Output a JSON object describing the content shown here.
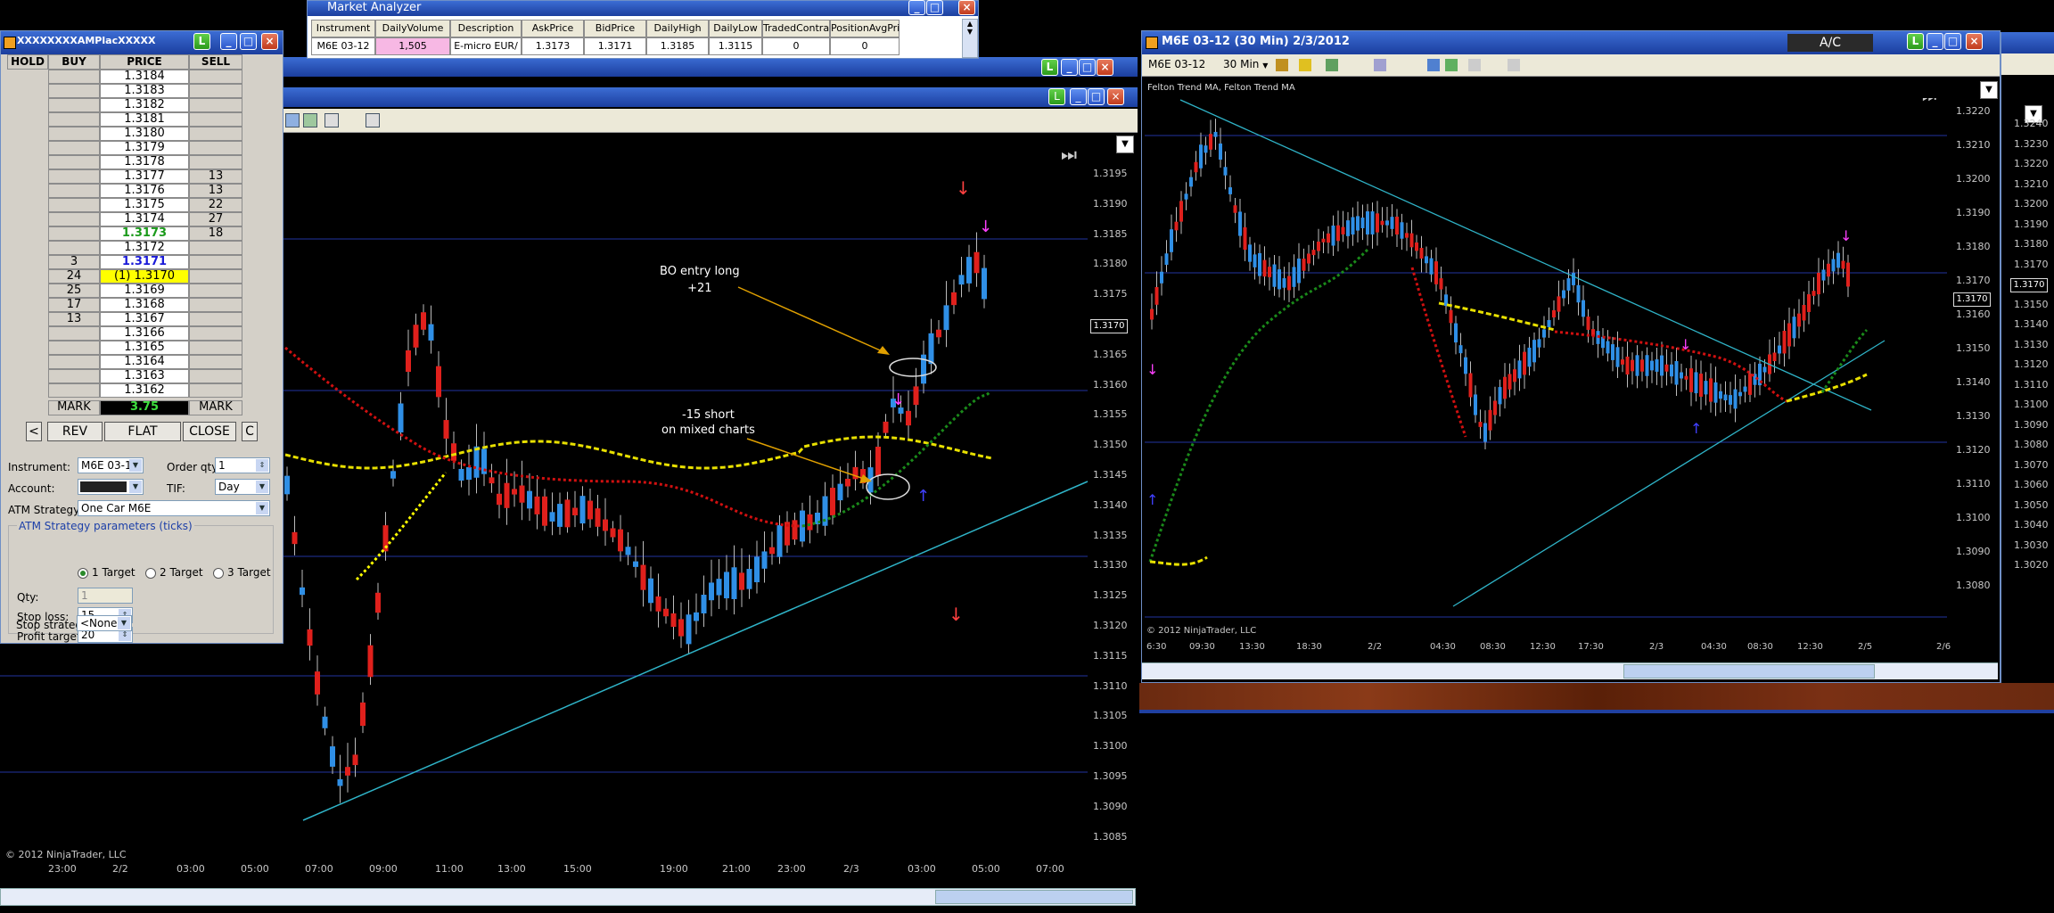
{
  "dom": {
    "title": "XXXXXXXXAMPlacXXXXX",
    "headers": [
      "HOLD",
      "BUY",
      "PRICE",
      "SELL"
    ],
    "rows": [
      {
        "buy": "",
        "price": "1.3184",
        "sell": ""
      },
      {
        "buy": "",
        "price": "1.3183",
        "sell": ""
      },
      {
        "buy": "",
        "price": "1.3182",
        "sell": ""
      },
      {
        "buy": "",
        "price": "1.3181",
        "sell": ""
      },
      {
        "buy": "",
        "price": "1.3180",
        "sell": ""
      },
      {
        "buy": "",
        "price": "1.3179",
        "sell": ""
      },
      {
        "buy": "",
        "price": "1.3178",
        "sell": ""
      },
      {
        "buy": "",
        "price": "1.3177",
        "sell": "13"
      },
      {
        "buy": "",
        "price": "1.3176",
        "sell": "13"
      },
      {
        "buy": "",
        "price": "1.3175",
        "sell": "22"
      },
      {
        "buy": "",
        "price": "1.3174",
        "sell": "27"
      },
      {
        "buy": "",
        "price": "1.3173",
        "sell": "18"
      },
      {
        "buy": "",
        "price": "1.3172",
        "sell": ""
      },
      {
        "buy": "3",
        "price": "1.3171",
        "sell": ""
      },
      {
        "buy": "24",
        "price": "(1) 1.3170",
        "sell": ""
      },
      {
        "buy": "25",
        "price": "1.3169",
        "sell": ""
      },
      {
        "buy": "17",
        "price": "1.3168",
        "sell": ""
      },
      {
        "buy": "13",
        "price": "1.3167",
        "sell": ""
      },
      {
        "buy": "",
        "price": "1.3166",
        "sell": ""
      },
      {
        "buy": "",
        "price": "1.3165",
        "sell": ""
      },
      {
        "buy": "",
        "price": "1.3164",
        "sell": ""
      },
      {
        "buy": "",
        "price": "1.3163",
        "sell": ""
      },
      {
        "buy": "",
        "price": "1.3162",
        "sell": ""
      }
    ],
    "mark_left": "MARK",
    "mark_value": "3.75",
    "mark_right": "MARK",
    "btn_left": "<",
    "btn_rev": "REV",
    "btn_flat": "FLAT",
    "btn_close": "CLOSE",
    "btn_c": "C",
    "instrument_label": "Instrument:",
    "instrument_value": "M6E 03-12",
    "orderqty_label": "Order qty:",
    "orderqty_value": "1",
    "account_label": "Account:",
    "tif_label": "TIF:",
    "tif_value": "Day",
    "atm_label": "ATM Strategy:",
    "atm_value": "One Car M6E",
    "atm_params_label": "ATM Strategy parameters (ticks)",
    "target1": "1 Target",
    "target2": "2 Target",
    "target3": "3 Target",
    "qty_label": "Qty:",
    "qty_value": "1",
    "stoploss_label": "Stop loss:",
    "stoploss_value": "15",
    "profit_label": "Profit target:",
    "profit_value": "20",
    "stopstrat_label": "Stop strategy:",
    "stopstrat_value": "<None>"
  },
  "market_analyzer": {
    "title": "Market Analyzer",
    "columns": [
      "Instrument",
      "DailyVolume",
      "Description",
      "AskPrice",
      "BidPrice",
      "DailyHigh",
      "DailyLow",
      "TradedContra",
      "PositionAvgPri"
    ],
    "row": [
      "M6E 03-12",
      "1,505",
      "E-micro EUR/",
      "1.3173",
      "1.3171",
      "1.3185",
      "1.3115",
      "0",
      "0"
    ]
  },
  "chart_left": {
    "copyright": "© 2012 NinjaTrader, LLC",
    "price_ticks": [
      "1.3195",
      "1.3190",
      "1.3185",
      "1.3180",
      "1.3175",
      "1.3170",
      "1.3165",
      "1.3160",
      "1.3155",
      "1.3150",
      "1.3145",
      "1.3140",
      "1.3135",
      "1.3130",
      "1.3125",
      "1.3120",
      "1.3115",
      "1.3110",
      "1.3105",
      "1.3100",
      "1.3095",
      "1.3090",
      "1.3085"
    ],
    "time_ticks": [
      "23:00",
      "2/2",
      "03:00",
      "05:00",
      "07:00",
      "09:00",
      "11:00",
      "13:00",
      "15:00",
      "19:00",
      "21:00",
      "23:00",
      "2/3",
      "03:00",
      "05:00",
      "07:00"
    ],
    "price_marker": "1.3170",
    "annotation_1_line1": "BO entry long",
    "annotation_1_line2": "+21",
    "annotation_2_line1": "-15 short",
    "annotation_2_line2": "on mixed charts"
  },
  "chart_right": {
    "title": "M6E 03-12 (30 Min)  2/3/2012",
    "ac_label": "A/C",
    "instrument_dd": "M6E 03-12",
    "interval_dd": "30 Min",
    "indicator_label": "Felton Trend MA, Felton Trend MA",
    "copyright": "© 2012 NinjaTrader, LLC",
    "price_ticks": [
      "1.3220",
      "1.3210",
      "1.3200",
      "1.3190",
      "1.3180",
      "1.3170",
      "1.3160",
      "1.3150",
      "1.3140",
      "1.3130",
      "1.3120",
      "1.3110",
      "1.3100",
      "1.3090",
      "1.3080"
    ],
    "time_ticks": [
      "6:30",
      "09:30",
      "13:30",
      "18:30",
      "2/2",
      "04:30",
      "08:30",
      "12:30",
      "17:30",
      "2/3",
      "04:30",
      "08:30",
      "12:30",
      "2/5",
      "2/6"
    ],
    "price_marker": "1.3170",
    "far_ticks": [
      "1.3240",
      "1.3230",
      "1.3220",
      "1.3210",
      "1.3200",
      "1.3190",
      "1.3180",
      "1.3170",
      "1.3160",
      "1.3150",
      "1.3140",
      "1.3130",
      "1.3120",
      "1.3110",
      "1.3100",
      "1.3090",
      "1.3080",
      "1.3070",
      "1.3060",
      "1.3050",
      "1.3040",
      "1.3030",
      "1.3020"
    ],
    "far_marker": "1.3170"
  },
  "colors": {
    "bull": "#2f8fe6",
    "bear": "#e0201c",
    "grid": "#2233a0",
    "trendline": "#2fb3c7",
    "ma_yellow": "#e8e000",
    "ma_red": "#d01010",
    "ma_green": "#1a8a1a"
  }
}
